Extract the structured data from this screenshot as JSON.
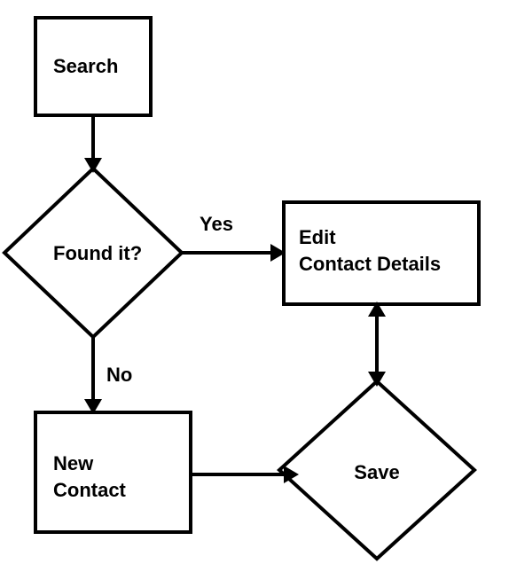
{
  "nodes": {
    "search": {
      "label": "Search"
    },
    "found": {
      "label": "Found it?"
    },
    "edit1": {
      "label": "Edit"
    },
    "edit2": {
      "label": "Contact Details"
    },
    "new1": {
      "label": "New"
    },
    "new2": {
      "label": "Contact"
    },
    "save": {
      "label": "Save"
    }
  },
  "edges": {
    "yes": {
      "label": "Yes"
    },
    "no": {
      "label": "No"
    }
  }
}
